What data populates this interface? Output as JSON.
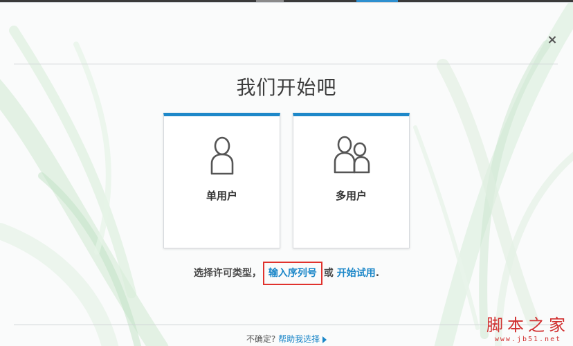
{
  "dialog": {
    "title": "我们开始吧",
    "close_symbol": "×",
    "close_icon": "close-icon"
  },
  "cards": {
    "single": {
      "label": "单用户",
      "icon": "single-user-icon"
    },
    "multi": {
      "label": "多用户",
      "icon": "multi-user-icon"
    }
  },
  "license": {
    "prefix": "选择许可类型，",
    "serial_link": "输入序列号",
    "middle": "或",
    "trial_link": "开始试用",
    "suffix": "."
  },
  "footer": {
    "question": "不确定?",
    "help_link": "帮助我选择",
    "arrow_icon": "play-arrow-icon"
  },
  "watermark": {
    "main": "脚本之家",
    "sub": "www.jb51.net"
  },
  "colors": {
    "accent": "#1e88c9",
    "link": "#1a86c8",
    "highlight_box": "#e0322d",
    "watermark": "#d12f2f"
  }
}
